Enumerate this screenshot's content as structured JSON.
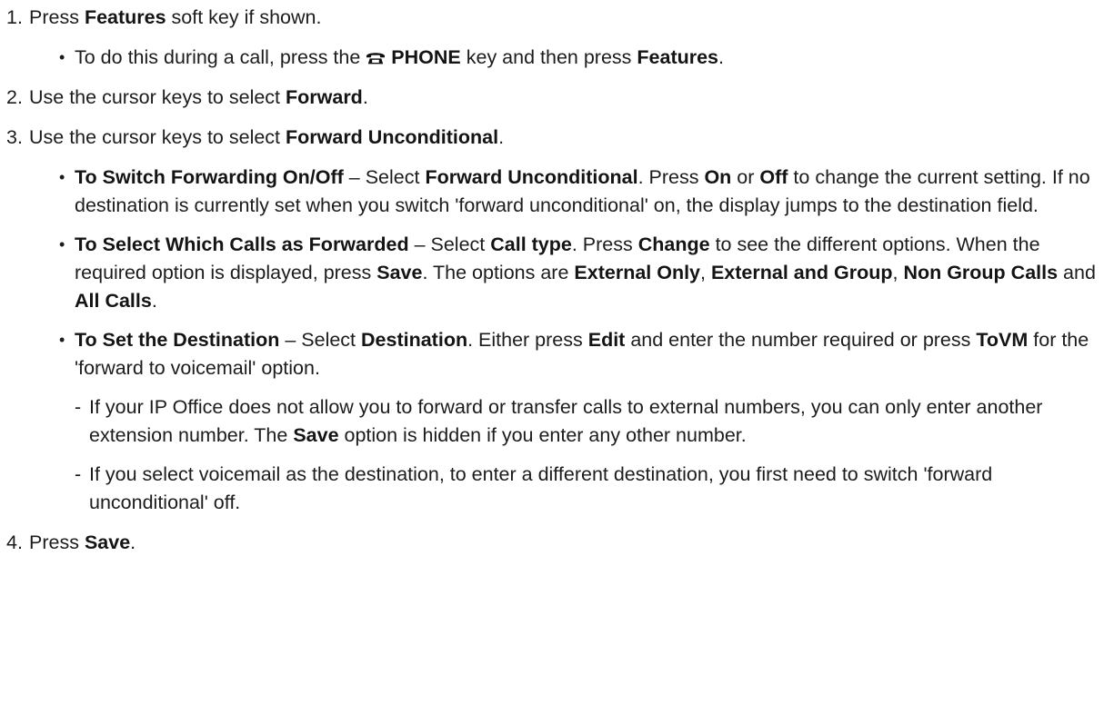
{
  "steps": [
    {
      "num": "1.",
      "parts": [
        {
          "t": "Press "
        },
        {
          "b": "Features"
        },
        {
          "t": " soft key if shown."
        }
      ]
    },
    {
      "num": "2.",
      "parts": [
        {
          "t": "Use the cursor keys to select "
        },
        {
          "b": "Forward"
        },
        {
          "t": "."
        }
      ]
    },
    {
      "num": "3.",
      "parts": [
        {
          "t": "Use the cursor keys to select "
        },
        {
          "b": "Forward Unconditional"
        },
        {
          "t": "."
        }
      ]
    },
    {
      "num": "4.",
      "parts": [
        {
          "t": "Press "
        },
        {
          "b": "Save"
        },
        {
          "t": "."
        }
      ]
    }
  ],
  "step1_sub": {
    "bullet": "•",
    "parts": [
      {
        "t": "To do this during a call, press the "
      },
      {
        "icon": "phone-icon"
      },
      {
        "b": "PHONE"
      },
      {
        "t": " key and then press "
      },
      {
        "b": "Features"
      },
      {
        "t": "."
      }
    ]
  },
  "step3_subs": [
    {
      "bullet": "•",
      "parts": [
        {
          "b": "To Switch Forwarding On/Off"
        },
        {
          "t": " – Select "
        },
        {
          "b": "Forward Unconditional"
        },
        {
          "t": ". Press "
        },
        {
          "b": "On"
        },
        {
          "t": " or "
        },
        {
          "b": "Off"
        },
        {
          "t": " to change the current setting. If no destination is currently set when you switch 'forward unconditional' on, the display jumps to the destination field."
        }
      ]
    },
    {
      "bullet": "•",
      "parts": [
        {
          "b": "To Select Which Calls as Forwarded"
        },
        {
          "t": " – Select "
        },
        {
          "b": "Call type"
        },
        {
          "t": ". Press "
        },
        {
          "b": "Change"
        },
        {
          "t": " to see the different options. When the required option is displayed, press "
        },
        {
          "b": "Save"
        },
        {
          "t": ". The options are "
        },
        {
          "b": "External Only"
        },
        {
          "t": ", "
        },
        {
          "b": "External and Group"
        },
        {
          "t": ", "
        },
        {
          "b": "Non Group Calls"
        },
        {
          "t": " and "
        },
        {
          "b": "All Calls"
        },
        {
          "t": "."
        }
      ]
    },
    {
      "bullet": "•",
      "parts": [
        {
          "b": "To Set the Destination"
        },
        {
          "t": " – Select "
        },
        {
          "b": "Destination"
        },
        {
          "t": ". Either press "
        },
        {
          "b": "Edit"
        },
        {
          "t": " and enter the number required or press "
        },
        {
          "b": "ToVM"
        },
        {
          "t": " for the 'forward to voicemail' option."
        }
      ]
    }
  ],
  "destination_notes": [
    {
      "dash": "-",
      "parts": [
        {
          "t": "If your IP Office does not allow you to forward or transfer calls to external numbers, you can only enter another extension number. The "
        },
        {
          "b": "Save"
        },
        {
          "t": " option is hidden if you enter any other number."
        }
      ]
    },
    {
      "dash": "-",
      "parts": [
        {
          "t": "If you select voicemail as the destination, to enter a different destination, you first need to switch 'forward unconditional' off."
        }
      ]
    }
  ]
}
